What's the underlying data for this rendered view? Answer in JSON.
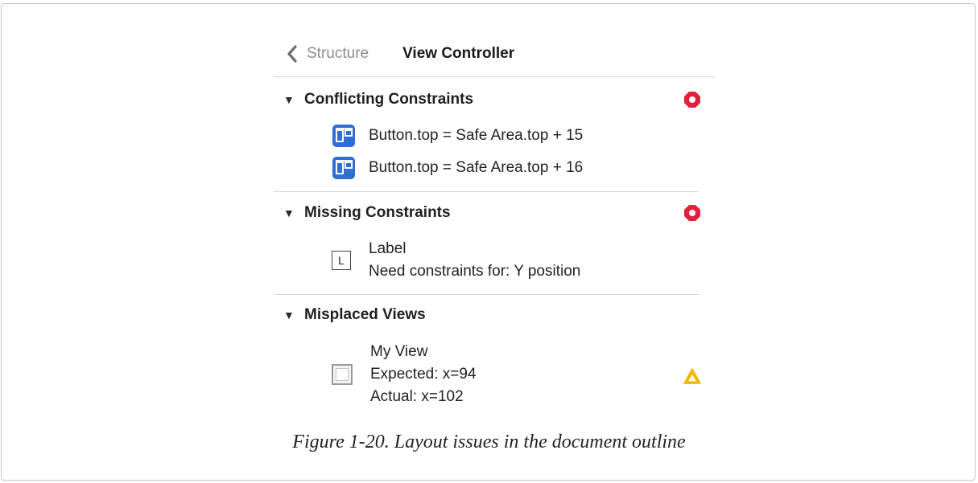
{
  "nav": {
    "back_label": "Structure",
    "title": "View Controller"
  },
  "sections": [
    {
      "title": "Conflicting Constraints",
      "status": "error",
      "items": [
        {
          "text": "Button.top = Safe Area.top + 15",
          "icon": "constraint-icon"
        },
        {
          "text": "Button.top = Safe Area.top + 16",
          "icon": "constraint-icon"
        }
      ]
    },
    {
      "title": "Missing Constraints",
      "status": "error",
      "items": [
        {
          "icon": "label-icon",
          "icon_glyph": "L",
          "name": "Label",
          "detail": "Need constraints for: Y position"
        }
      ]
    },
    {
      "title": "Misplaced Views",
      "status": "warning",
      "items": [
        {
          "icon": "view-icon",
          "name": "My View",
          "expected": "Expected: x=94",
          "actual": "Actual: x=102"
        }
      ]
    }
  ],
  "caption": "Figure 1-20. Layout issues in the document outline",
  "colors": {
    "error": "#e0213a",
    "warning": "#f5b400",
    "constraint": "#2f6fd0"
  }
}
